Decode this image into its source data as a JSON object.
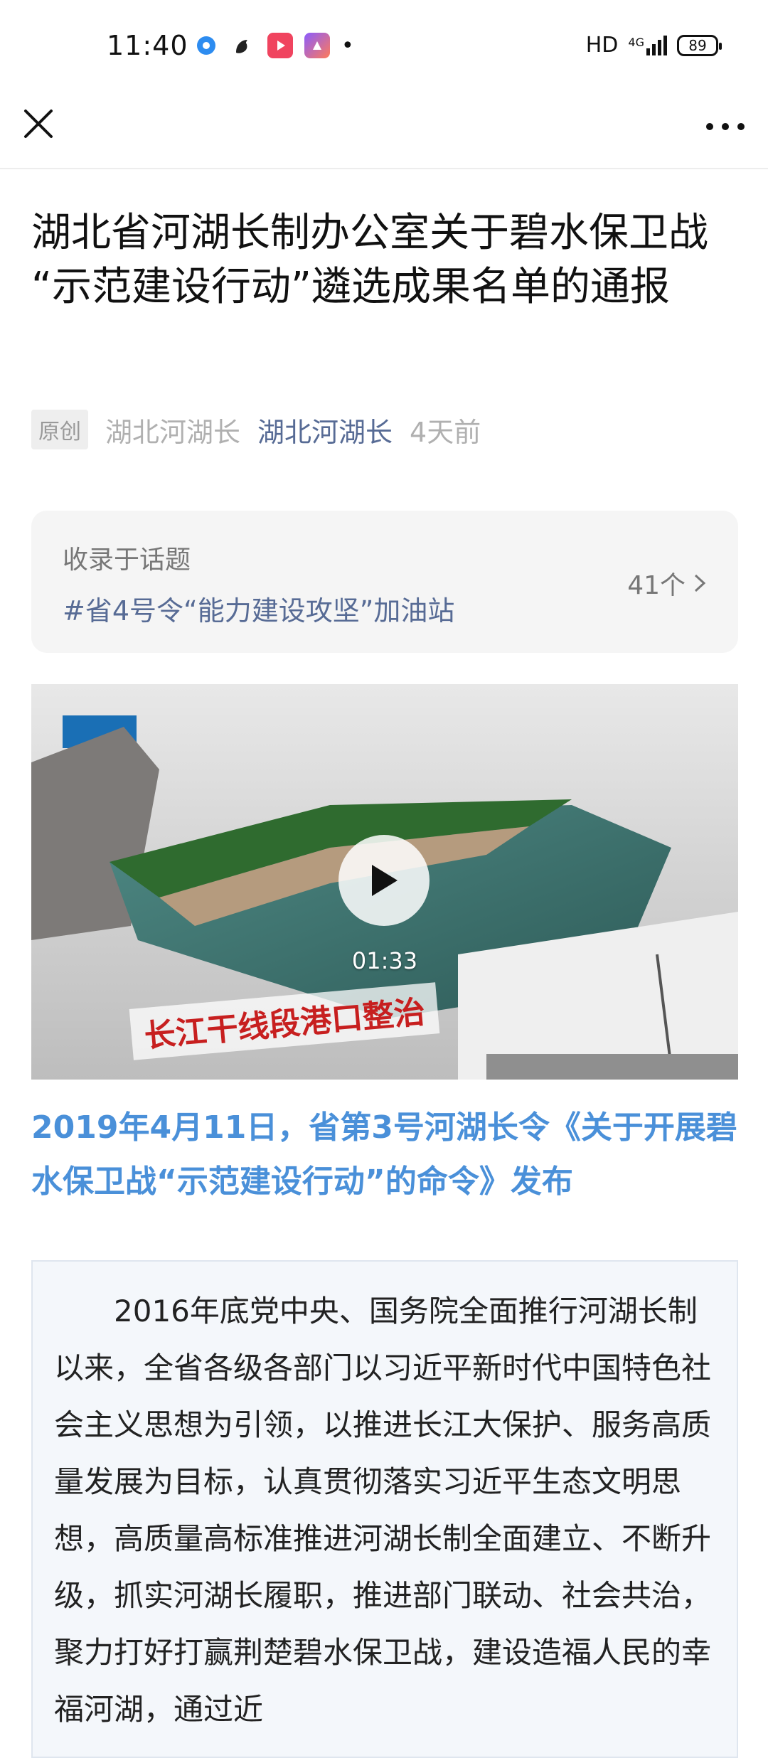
{
  "status_bar": {
    "time": "11:40",
    "network": "HD",
    "signal": "4G",
    "battery": "89",
    "app_icons": [
      "circle-app-icon",
      "squirrel-app-icon",
      "video-app-icon",
      "purple-app-icon"
    ],
    "dot": "•"
  },
  "top_nav": {
    "close_icon": "close-icon",
    "more_icon": "more-icon"
  },
  "article": {
    "title": "湖北省河湖长制办公室关于碧水保卫战 “示范建设行动”遴选成果名单的通报",
    "badge": "原创",
    "author": "湖北河湖长",
    "account": "湖北河湖长",
    "time": "4天前",
    "topic_label": "收录于话题",
    "topic_name": "#省4号令“能力建设攻坚”加油站",
    "topic_count": "41个",
    "video": {
      "duration": "01:33",
      "caption": "长江干线段港口整治"
    },
    "highlight": "2019年4月11日，省第3号河湖长令《关于开展碧水保卫战“示范建设行动”的命令》发布",
    "body": "2016年底党中央、国务院全面推行河湖长制以来，全省各级各部门以习近平新时代中国特色社会主义思想为引领，以推进长江大保护、服务高质量发展为目标，认真贯彻落实习近平生态文明思想，高质量高标准推进河湖长制全面建立、不断升级，抓实河湖长履职，推进部门联动、社会共治，聚力打好打赢荆楚碧水保卫战，建设造福人民的幸福河湖，通过近"
  },
  "colors": {
    "link": "#576b95",
    "highlight": "#4a90d9",
    "muted": "#b0b0b0"
  }
}
